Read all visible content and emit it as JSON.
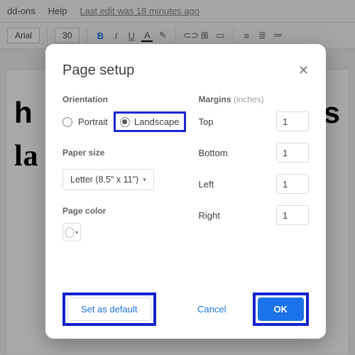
{
  "menubar": {
    "addons": "dd-ons",
    "help": "Help",
    "edit_status": "Last edit was 18 minutes ago"
  },
  "toolbar": {
    "font": "Arial",
    "size": "30",
    "bold_glyph": "B",
    "italic_glyph": "I",
    "underline_glyph": "U",
    "textcolor_glyph": "A"
  },
  "document": {
    "line1": "h",
    "line2": "la",
    "line1_suffix": "ocs"
  },
  "dialog": {
    "title": "Page setup",
    "close_glyph": "✕",
    "orientation": {
      "label": "Orientation",
      "portrait": "Portrait",
      "landscape": "Landscape",
      "selected": "landscape"
    },
    "paper": {
      "label": "Paper size",
      "value": "Letter (8.5\" x 11\")"
    },
    "color": {
      "label": "Page color"
    },
    "margins": {
      "label": "Margins",
      "unit": "(inches)",
      "top_label": "Top",
      "top_value": "1",
      "bottom_label": "Bottom",
      "bottom_value": "1",
      "left_label": "Left",
      "left_value": "1",
      "right_label": "Right",
      "right_value": "1"
    },
    "buttons": {
      "set_default": "Set as default",
      "cancel": "Cancel",
      "ok": "OK"
    }
  },
  "caret_glyph": "▾"
}
